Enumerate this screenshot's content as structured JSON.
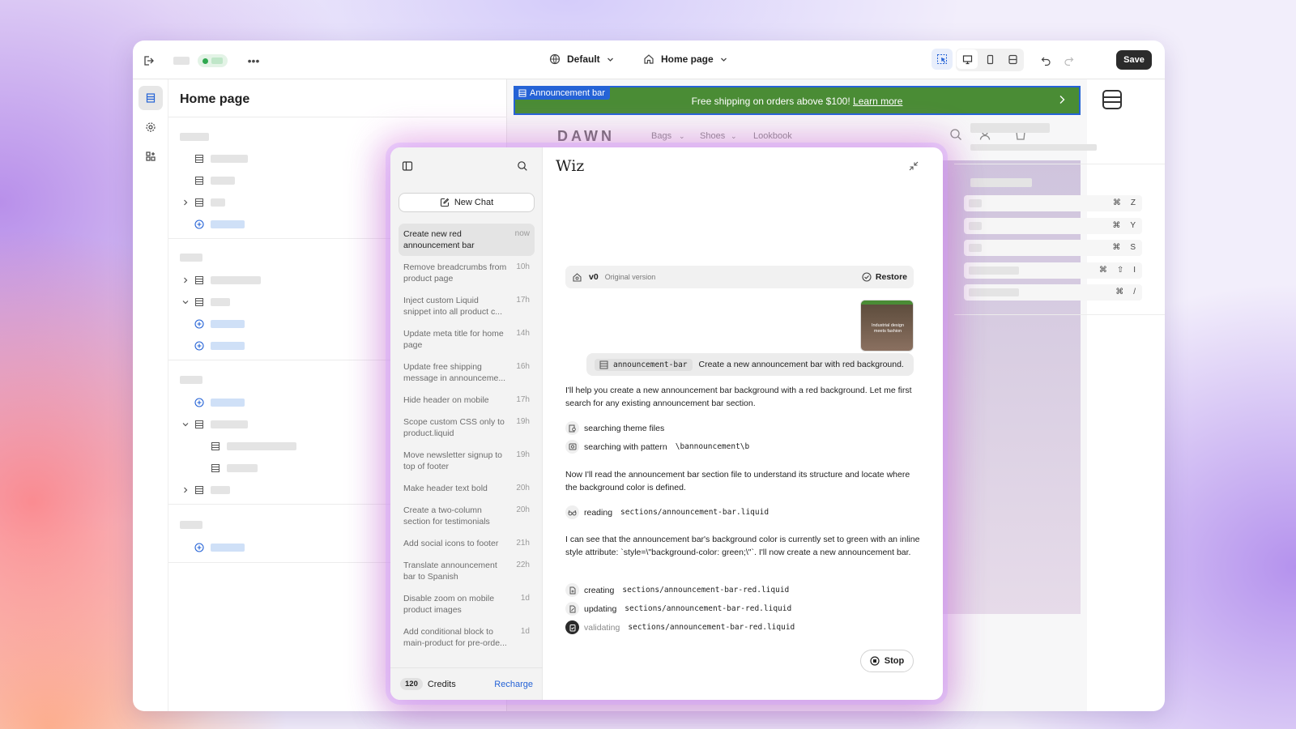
{
  "topbar": {
    "theme_label": "Default",
    "page_label": "Home page",
    "save_label": "Save"
  },
  "sidebar": {
    "title": "Home page"
  },
  "announcement": {
    "tag": "Announcement bar",
    "text": "Free shipping on orders above $100!",
    "link": "Learn more"
  },
  "store": {
    "logo": "DAWN",
    "nav": [
      "Bags",
      "Shoes",
      "Lookbook"
    ]
  },
  "chat": {
    "brand": "Wiz",
    "new_chat_label": "New Chat",
    "history": [
      {
        "title": "Create new red announcement bar",
        "time": "now"
      },
      {
        "title": "Remove breadcrumbs from product page",
        "time": "10h"
      },
      {
        "title": "Inject custom Liquid snippet into all product c...",
        "time": "17h"
      },
      {
        "title": "Update meta title for home page",
        "time": "14h"
      },
      {
        "title": "Update free shipping message in announceme...",
        "time": "16h"
      },
      {
        "title": "Hide header on mobile",
        "time": "17h"
      },
      {
        "title": "Scope custom CSS only to product.liquid",
        "time": "19h"
      },
      {
        "title": "Move newsletter signup to top of footer",
        "time": "19h"
      },
      {
        "title": "Make header text bold",
        "time": "20h"
      },
      {
        "title": "Create a two-column section for testimonials",
        "time": "20h"
      },
      {
        "title": "Add social icons to footer",
        "time": "21h"
      },
      {
        "title": "Translate announcement bar to Spanish",
        "time": "22h"
      },
      {
        "title": "Disable zoom on mobile product images",
        "time": "1d"
      },
      {
        "title": "Add conditional block to main-product for pre-orde...",
        "time": "1d"
      }
    ],
    "credits_count": "120",
    "credits_label": "Credits",
    "recharge_label": "Recharge",
    "version": {
      "name": "v0",
      "label": "Original version",
      "restore": "Restore"
    },
    "thumb_text": "Industrial design meets fashion",
    "user_message": {
      "chip": "announcement-bar",
      "text": "Create a new announcement bar with red background."
    },
    "reply_1": "I'll help you create a new announcement bar background with a red background. Let me first search for any existing announcement bar section.",
    "steps_1": [
      {
        "verb": "searching theme files",
        "arg": ""
      },
      {
        "verb": "searching with pattern",
        "arg": "\\bannouncement\\b"
      }
    ],
    "reply_2": "Now I'll read the announcement bar section file to understand its structure and locate where the background color is defined.",
    "step_read": {
      "verb": "reading",
      "arg": "sections/announcement-bar.liquid"
    },
    "reply_3": "I can see that the announcement bar's background color is currently set to green with an inline style attribute: `style=\\\"background-color: green;\\\"`. I'll now create a new announcement bar.",
    "steps_2": [
      {
        "verb": "creating",
        "arg": "sections/announcement-bar-red.liquid"
      },
      {
        "verb": "updating",
        "arg": "sections/announcement-bar-red.liquid"
      },
      {
        "verb": "validating",
        "arg": "sections/announcement-bar-red.liquid"
      }
    ],
    "stop_label": "Stop"
  },
  "shortcuts": [
    {
      "keys": [
        "⌘",
        "Z"
      ]
    },
    {
      "keys": [
        "⌘",
        "Y"
      ]
    },
    {
      "keys": [
        "⌘",
        "S"
      ]
    },
    {
      "keys": [
        "⌘",
        "⇧",
        "I"
      ]
    },
    {
      "keys": [
        "⌘",
        "/"
      ]
    }
  ],
  "colors": {
    "announcement_bg": "#4a8c35",
    "selection": "#2563d6",
    "accent_link": "#2563d6",
    "save_bg": "#2b2b2b"
  }
}
